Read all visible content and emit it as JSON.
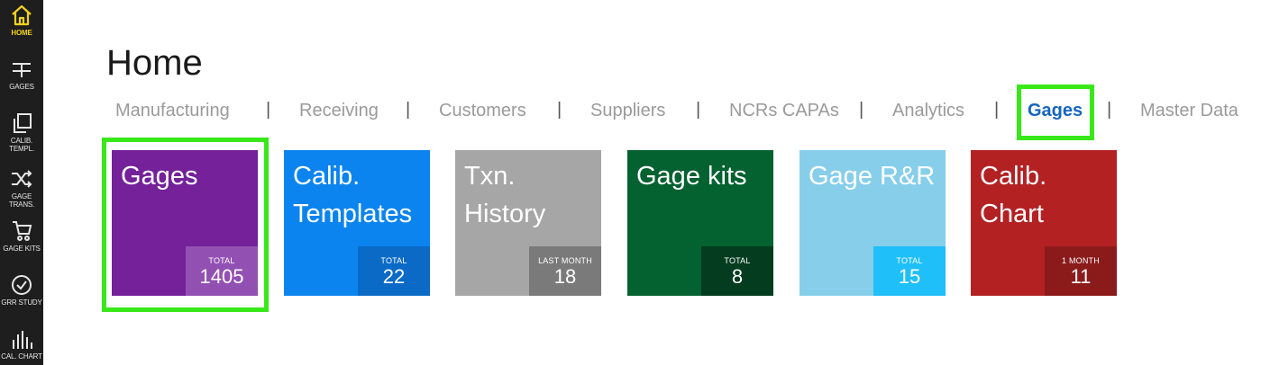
{
  "sidebar": {
    "items": [
      {
        "label": "HOME",
        "icon": "home-icon"
      },
      {
        "label": "GAGES",
        "icon": "gage-icon"
      },
      {
        "label": "CALIB.\nTEMPL.",
        "icon": "copy-icon"
      },
      {
        "label": "GAGE\nTRANS.",
        "icon": "shuffle-icon"
      },
      {
        "label": "GAGE KITS",
        "icon": "cart-icon"
      },
      {
        "label": "GRR STUDY",
        "icon": "check-circle-icon"
      },
      {
        "label": "CAL. CHART",
        "icon": "bar-chart-icon"
      }
    ],
    "active_color": "#f2d21a"
  },
  "page": {
    "title": "Home"
  },
  "tabs": [
    {
      "label": "Manufacturing"
    },
    {
      "label": "Receiving"
    },
    {
      "label": "Customers"
    },
    {
      "label": "Suppliers"
    },
    {
      "label": "NCRs CAPAs"
    },
    {
      "label": "Analytics"
    },
    {
      "label": "Gages"
    },
    {
      "label": "Master Data"
    }
  ],
  "tab_separator": "|",
  "active_tab": "Gages",
  "tiles": [
    {
      "title": "Gages",
      "caption": "TOTAL",
      "value": "1405",
      "color": "#74219a",
      "stat_color": "#9350b3"
    },
    {
      "title": "Calib.\nTemplates",
      "caption": "TOTAL",
      "value": "22",
      "color": "#0c84ef",
      "stat_color": "#0a6ac6"
    },
    {
      "title": "Txn.\nHistory",
      "caption": "LAST MONTH",
      "value": "18",
      "color": "#a6a6a6",
      "stat_color": "#7a7a7a"
    },
    {
      "title": "Gage kits",
      "caption": "TOTAL",
      "value": "8",
      "color": "#046130",
      "stat_color": "#033c1e"
    },
    {
      "title": "Gage R&R",
      "caption": "TOTAL",
      "value": "15",
      "color": "#87ceeb",
      "stat_color": "#1fbff9"
    },
    {
      "title": "Calib.\nChart",
      "caption": "1 MONTH",
      "value": "11",
      "color": "#b32123",
      "stat_color": "#8b1a1b"
    }
  ],
  "highlight_color": "#38e818"
}
